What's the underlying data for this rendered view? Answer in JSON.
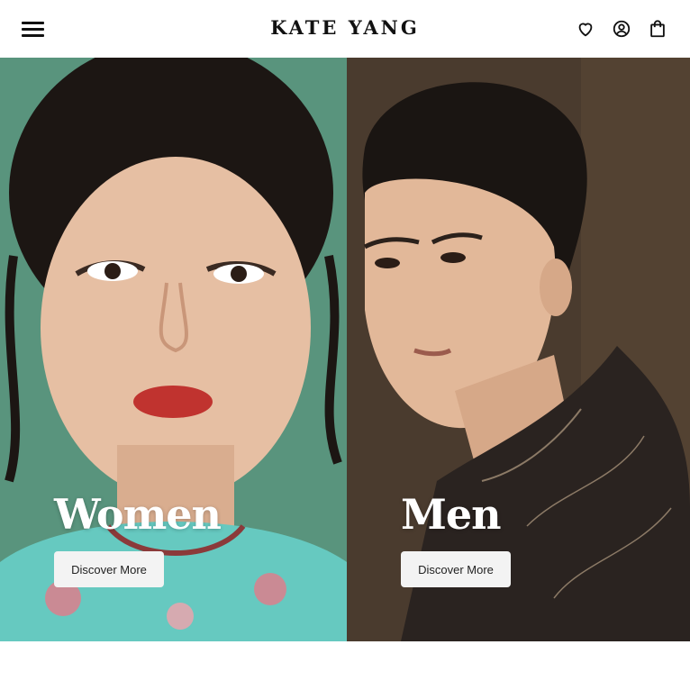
{
  "header": {
    "brand": "KATE YANG",
    "icons": [
      "menu-icon",
      "heart-icon",
      "account-icon",
      "bag-icon"
    ]
  },
  "hero": {
    "panels": [
      {
        "title": "Women",
        "cta": "Discover More",
        "background": "#5f9a83"
      },
      {
        "title": "Men",
        "cta": "Discover More",
        "background": "#4a3b2e"
      }
    ]
  },
  "colors": {
    "text": "#111111",
    "button_bg": "#f3f3f3",
    "title": "#ffffff"
  }
}
